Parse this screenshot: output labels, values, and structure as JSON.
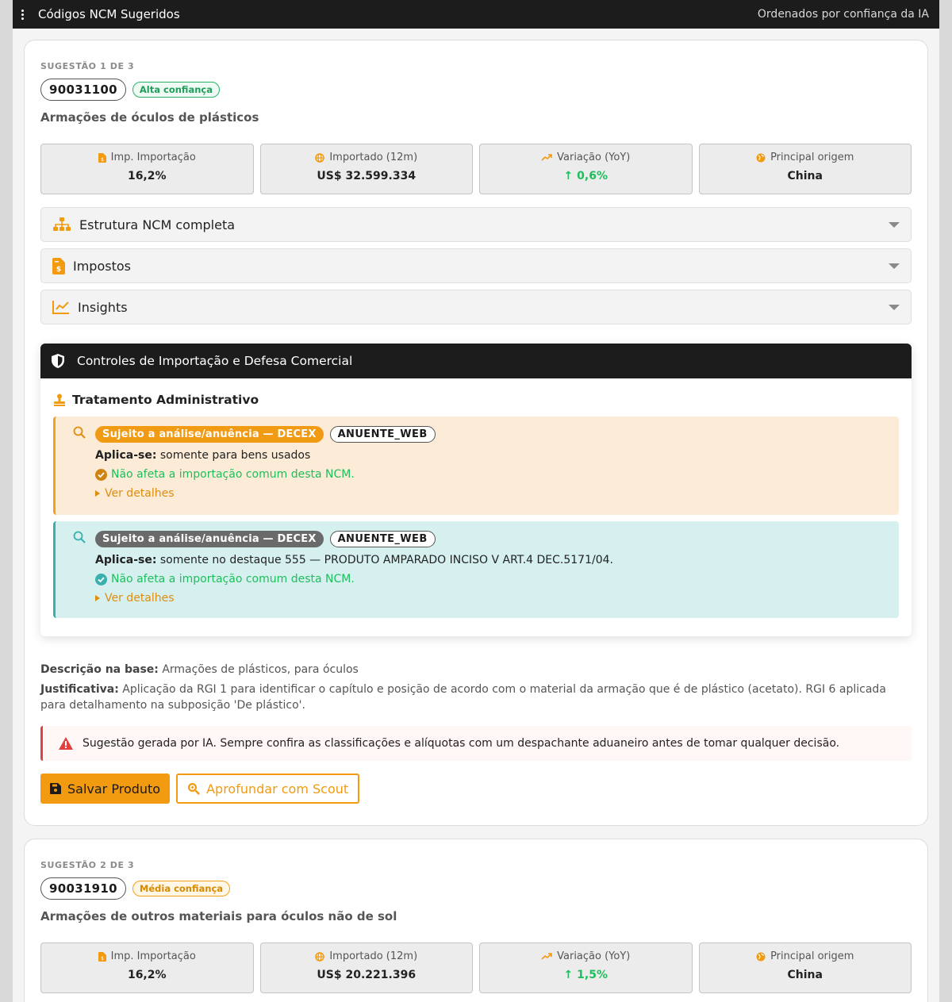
{
  "header": {
    "menu_icon": "kebab-menu-icon",
    "title": "Códigos NCM Sugeridos",
    "subtitle": "Ordenados por confiança da IA"
  },
  "suggestions": [
    {
      "eyebrow": "SUGESTÃO 1 DE 3",
      "code": "90031100",
      "confidence": "Alta confiança",
      "title": "Armações de óculos de plásticos",
      "stats": [
        {
          "label": "Imp. Importação",
          "value": "16,2%",
          "icon": "tax-document-icon"
        },
        {
          "label": "Importado (12m)",
          "value": "US$ 32.599.334",
          "icon": "globe-icon"
        },
        {
          "label": "Variação (YoY)",
          "value": "0,6%",
          "icon": "trend-up-icon",
          "arrow": "↑"
        },
        {
          "label": "Principal origem",
          "value": "China",
          "icon": "earth-icon"
        }
      ],
      "accordions": [
        {
          "label": "Estrutura NCM completa",
          "icon": "sitemap-icon"
        },
        {
          "label": "Impostos",
          "icon": "invoice-dollar-icon"
        },
        {
          "label": "Insights",
          "icon": "line-chart-icon"
        }
      ],
      "controls": {
        "title": "Controles de Importação e Defesa Comercial",
        "section_title": "Tratamento Administrativo",
        "rules": [
          {
            "chip": "Sujeito a análise/anuência — DECEX",
            "tag": "ANUENTE_WEB",
            "applies_label": "Aplica-se:",
            "applies_text": "somente para bens usados",
            "ok_text": "Não afeta a importação comum desta NCM.",
            "details": "Ver detalhes"
          },
          {
            "chip": "Sujeito a análise/anuência — DECEX",
            "tag": "ANUENTE_WEB",
            "applies_label": "Aplica-se:",
            "applies_text": "somente no destaque 555 — PRODUTO AMPARADO INCISO V ART.4 DEC.5171/04.",
            "ok_text": "Não afeta a importação comum desta NCM.",
            "details": "Ver detalhes"
          }
        ]
      },
      "description_label": "Descrição na base:",
      "description": "Armações de plásticos, para óculos",
      "justification_label": "Justificativa:",
      "justification": "Aplicação da RGI 1 para identificar o capítulo e posição de acordo com o material da armação que é de plástico (acetato). RGI 6 aplicada para detalhamento na subposição 'De plástico'.",
      "warning": "Sugestão gerada por IA. Sempre confira as classificações e alíquotas com um despachante aduaneiro antes de tomar qualquer decisão.",
      "save_button": "Salvar Produto",
      "scout_button": "Aprofundar com Scout"
    },
    {
      "eyebrow": "SUGESTÃO 2 DE 3",
      "code": "90031910",
      "confidence": "Média confiança",
      "title": "Armações de outros materiais para óculos não de sol",
      "stats": [
        {
          "label": "Imp. Importação",
          "value": "16,2%",
          "icon": "tax-document-icon"
        },
        {
          "label": "Importado (12m)",
          "value": "US$ 20.221.396",
          "icon": "globe-icon"
        },
        {
          "label": "Variação (YoY)",
          "value": "1,5%",
          "icon": "trend-up-icon",
          "arrow": "↑"
        },
        {
          "label": "Principal origem",
          "value": "China",
          "icon": "earth-icon"
        }
      ]
    }
  ],
  "colors": {
    "accent": "#f29a10",
    "success": "#1fbe5c",
    "dark": "#1c1c1c",
    "teal": "#3ab0ad",
    "danger": "#e04040"
  }
}
